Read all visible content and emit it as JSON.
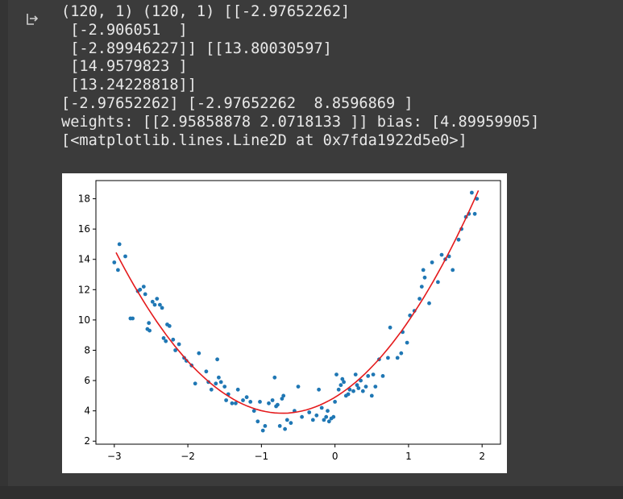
{
  "output": {
    "lines": [
      "(120, 1) (120, 1) [[-2.97652262]",
      " [-2.906051  ]",
      " [-2.89946227]] [[13.80030597]",
      " [14.9579823 ]",
      " [13.24228818]]",
      "[-2.97652262] [-2.97652262  8.8596869 ]",
      "weights: [[2.95858878 2.0718133 ]] bias: [4.89959905]",
      "[<matplotlib.lines.Line2D at 0x7fda1922d5e0>]"
    ]
  },
  "icons": {
    "output_icon": "output-arrow-icon"
  },
  "chart_data": {
    "type": "scatter",
    "xlim": [
      -3.25,
      2.25
    ],
    "ylim": [
      1.8,
      19.2
    ],
    "xticks": [
      -3,
      -2,
      -1,
      0,
      1,
      2
    ],
    "yticks": [
      2,
      4,
      6,
      8,
      10,
      12,
      14,
      16,
      18
    ],
    "xtick_labels": [
      "−3",
      "−2",
      "−1",
      "0",
      "1",
      "2"
    ],
    "ytick_labels": [
      "2",
      "4",
      "6",
      "8",
      "10",
      "12",
      "14",
      "16",
      "18"
    ],
    "grid": false,
    "colors": {
      "points": "#1f77b4",
      "curve": "#e41a1c",
      "axes": "#000000"
    },
    "series": [
      {
        "kind": "points",
        "points": [
          [
            -3.0,
            13.8
          ],
          [
            -2.95,
            13.3
          ],
          [
            -2.93,
            15.0
          ],
          [
            -2.85,
            14.2
          ],
          [
            -2.78,
            10.1
          ],
          [
            -2.75,
            10.1
          ],
          [
            -2.68,
            11.9
          ],
          [
            -2.65,
            12.0
          ],
          [
            -2.6,
            12.2
          ],
          [
            -2.58,
            11.7
          ],
          [
            -2.55,
            9.4
          ],
          [
            -2.53,
            9.8
          ],
          [
            -2.52,
            9.3
          ],
          [
            -2.48,
            11.2
          ],
          [
            -2.45,
            11.0
          ],
          [
            -2.42,
            11.4
          ],
          [
            -2.38,
            11.0
          ],
          [
            -2.35,
            10.8
          ],
          [
            -2.33,
            8.8
          ],
          [
            -2.3,
            8.6
          ],
          [
            -2.28,
            9.7
          ],
          [
            -2.25,
            9.6
          ],
          [
            -2.2,
            8.7
          ],
          [
            -2.17,
            8.0
          ],
          [
            -2.12,
            8.4
          ],
          [
            -2.05,
            7.5
          ],
          [
            -2.02,
            7.3
          ],
          [
            -1.95,
            7.0
          ],
          [
            -1.9,
            5.8
          ],
          [
            -1.85,
            7.8
          ],
          [
            -1.75,
            6.6
          ],
          [
            -1.72,
            5.9
          ],
          [
            -1.68,
            5.4
          ],
          [
            -1.62,
            5.8
          ],
          [
            -1.6,
            7.4
          ],
          [
            -1.58,
            6.2
          ],
          [
            -1.55,
            5.9
          ],
          [
            -1.5,
            5.6
          ],
          [
            -1.48,
            4.7
          ],
          [
            -1.45,
            5.1
          ],
          [
            -1.4,
            4.5
          ],
          [
            -1.35,
            4.5
          ],
          [
            -1.32,
            5.4
          ],
          [
            -1.25,
            4.7
          ],
          [
            -1.2,
            4.9
          ],
          [
            -1.15,
            4.6
          ],
          [
            -1.1,
            4.0
          ],
          [
            -1.05,
            3.3
          ],
          [
            -1.02,
            4.6
          ],
          [
            -0.98,
            2.7
          ],
          [
            -0.95,
            3.0
          ],
          [
            -0.9,
            4.5
          ],
          [
            -0.85,
            4.7
          ],
          [
            -0.82,
            6.2
          ],
          [
            -0.8,
            4.3
          ],
          [
            -0.78,
            4.4
          ],
          [
            -0.75,
            3.0
          ],
          [
            -0.72,
            4.8
          ],
          [
            -0.7,
            5.0
          ],
          [
            -0.68,
            2.8
          ],
          [
            -0.65,
            3.4
          ],
          [
            -0.6,
            3.2
          ],
          [
            -0.55,
            4.0
          ],
          [
            -0.5,
            5.6
          ],
          [
            -0.45,
            3.6
          ],
          [
            -0.35,
            3.9
          ],
          [
            -0.3,
            3.4
          ],
          [
            -0.25,
            3.7
          ],
          [
            -0.22,
            5.4
          ],
          [
            -0.18,
            4.2
          ],
          [
            -0.15,
            3.4
          ],
          [
            -0.12,
            3.6
          ],
          [
            -0.1,
            4.0
          ],
          [
            -0.08,
            3.3
          ],
          [
            -0.05,
            3.5
          ],
          [
            -0.02,
            3.6
          ],
          [
            0.0,
            4.6
          ],
          [
            0.02,
            6.4
          ],
          [
            0.05,
            5.4
          ],
          [
            0.08,
            5.7
          ],
          [
            0.1,
            6.1
          ],
          [
            0.12,
            5.9
          ],
          [
            0.15,
            5.0
          ],
          [
            0.18,
            5.1
          ],
          [
            0.2,
            5.4
          ],
          [
            0.25,
            5.3
          ],
          [
            0.28,
            6.4
          ],
          [
            0.3,
            5.7
          ],
          [
            0.32,
            5.5
          ],
          [
            0.35,
            6.0
          ],
          [
            0.38,
            5.3
          ],
          [
            0.42,
            5.6
          ],
          [
            0.45,
            6.3
          ],
          [
            0.5,
            5.0
          ],
          [
            0.52,
            6.4
          ],
          [
            0.55,
            5.6
          ],
          [
            0.6,
            7.4
          ],
          [
            0.65,
            6.3
          ],
          [
            0.72,
            7.5
          ],
          [
            0.75,
            9.5
          ],
          [
            0.85,
            7.5
          ],
          [
            0.9,
            7.8
          ],
          [
            0.92,
            9.2
          ],
          [
            0.98,
            8.5
          ],
          [
            1.02,
            10.3
          ],
          [
            1.08,
            10.6
          ],
          [
            1.15,
            11.4
          ],
          [
            1.18,
            12.2
          ],
          [
            1.2,
            13.3
          ],
          [
            1.22,
            12.8
          ],
          [
            1.28,
            11.1
          ],
          [
            1.32,
            13.8
          ],
          [
            1.4,
            12.5
          ],
          [
            1.45,
            14.3
          ],
          [
            1.5,
            14.0
          ],
          [
            1.55,
            14.2
          ],
          [
            1.6,
            13.3
          ],
          [
            1.68,
            15.3
          ],
          [
            1.72,
            16.0
          ],
          [
            1.78,
            16.8
          ],
          [
            1.82,
            17.0
          ],
          [
            1.86,
            18.4
          ],
          [
            1.9,
            17.0
          ],
          [
            1.93,
            18.0
          ]
        ]
      },
      {
        "kind": "line",
        "curve": {
          "type": "quadratic",
          "weights": [
            2.95858878,
            2.0718133
          ],
          "bias": 4.89959905,
          "x_range": [
            -2.97652262,
            1.95
          ]
        }
      }
    ]
  }
}
